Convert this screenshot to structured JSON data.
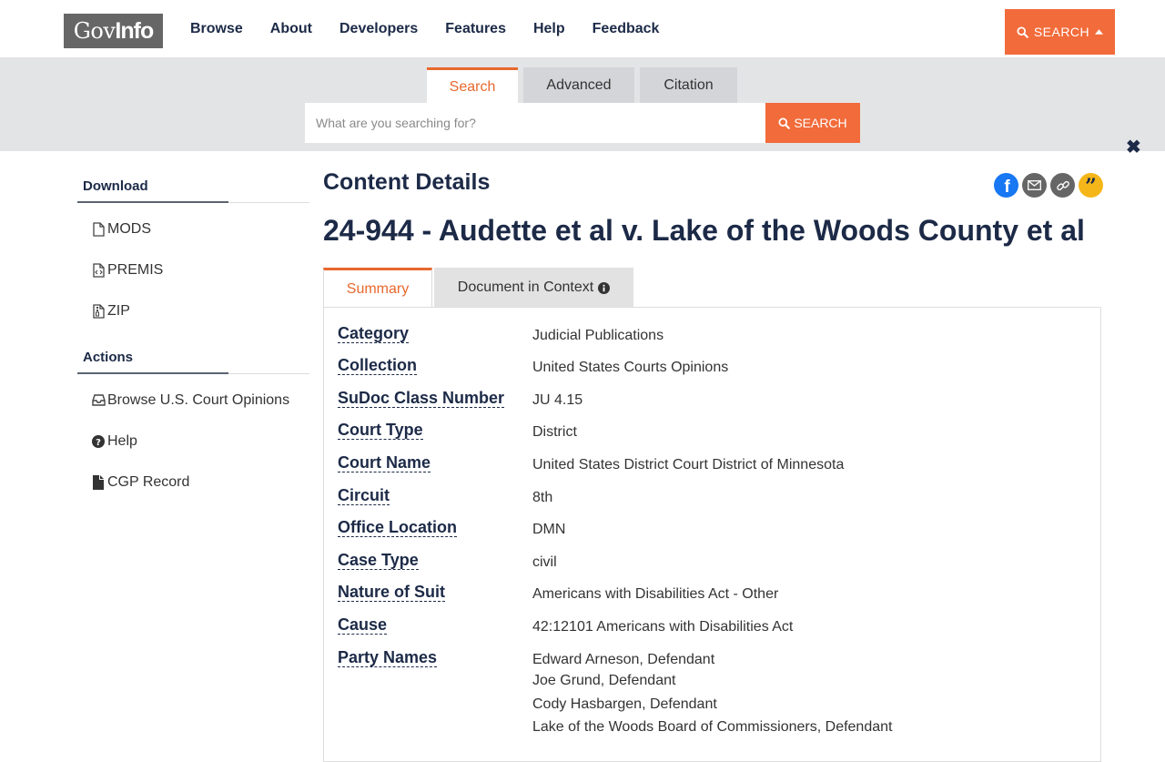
{
  "header": {
    "logo_gov": "Gov",
    "logo_info": "Info",
    "nav": [
      "Browse",
      "About",
      "Developers",
      "Features",
      "Help",
      "Feedback"
    ],
    "search_button": "SEARCH"
  },
  "search_band": {
    "tabs": [
      "Search",
      "Advanced",
      "Citation"
    ],
    "active_tab": "Search",
    "placeholder": "What are you searching for?",
    "button": "SEARCH",
    "close": "✖"
  },
  "sidebar": {
    "download_heading": "Download",
    "download_items": [
      "MODS",
      "PREMIS",
      "ZIP"
    ],
    "actions_heading": "Actions",
    "action_items": [
      "Browse U.S. Court Opinions",
      "Help",
      "CGP Record"
    ]
  },
  "main": {
    "heading": "Content Details",
    "title": "24-944 - Audette et al v. Lake of the Woods County et al",
    "tabs": [
      "Summary",
      "Document in Context"
    ],
    "details": [
      {
        "label": "Category",
        "value": "Judicial Publications"
      },
      {
        "label": "Collection",
        "value": "United States Courts Opinions"
      },
      {
        "label": "SuDoc Class Number",
        "value": "JU 4.15"
      },
      {
        "label": "Court Type",
        "value": "District"
      },
      {
        "label": "Court Name",
        "value": "United States District Court District of Minnesota"
      },
      {
        "label": "Circuit",
        "value": "8th"
      },
      {
        "label": "Office Location",
        "value": "DMN"
      },
      {
        "label": "Case Type",
        "value": "civil"
      },
      {
        "label": "Nature of Suit",
        "value": "Americans with Disabilities Act - Other"
      },
      {
        "label": "Cause",
        "value": "42:12101 Americans with Disabilities Act"
      },
      {
        "label": "Party Names",
        "value": "Edward Arneson, Defendant"
      }
    ],
    "party_names_more": [
      "Joe Grund, Defendant",
      "Cody Hasbargen, Defendant",
      "Lake of the Woods Board of Commissioners, Defendant"
    ]
  },
  "colors": {
    "accent": "#f26b3a",
    "navy": "#1c2a47",
    "facebook": "#1877f2",
    "quote": "#f5b619"
  }
}
